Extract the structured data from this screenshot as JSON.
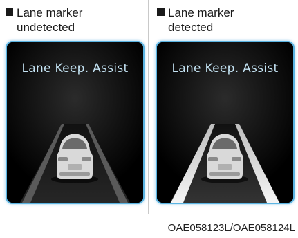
{
  "panels": [
    {
      "caption_line1": "Lane marker",
      "caption_line2": "undetected",
      "display_title": "Lane Keep. Assist",
      "lane_lines": "undetected"
    },
    {
      "caption_line1": "Lane marker",
      "caption_line2": "detected",
      "display_title": "Lane Keep. Assist",
      "lane_lines": "detected"
    }
  ],
  "figure_code": "OAE058123L/OAE058124L",
  "colors": {
    "panel_border": "#5bb4e2",
    "title_text": "#c4e3f3",
    "lane_undetected": "#5a5a5a",
    "lane_detected": "#e6e6e6"
  }
}
